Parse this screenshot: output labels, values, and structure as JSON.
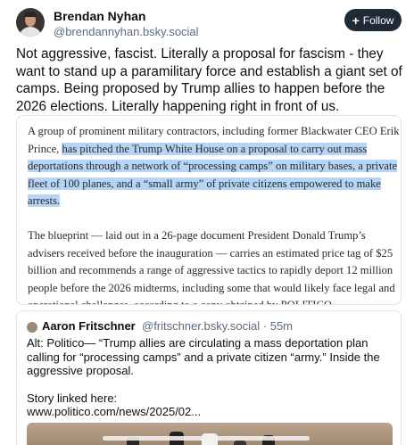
{
  "author": {
    "display_name": "Brendan Nyhan",
    "handle": "@brendannyhan.bsky.social",
    "avatar_icon": "user-avatar"
  },
  "follow_button": {
    "icon": "plus-icon",
    "label": "Follow"
  },
  "post": {
    "text": "Not aggressive, fascist. Literally a proposal for fascism - they want to stand up a paramilitary force and establish a giant set of camps. Being proposed by Trump allies to happen before the 2026 elections. Literally happening right in front of us."
  },
  "image_article": {
    "p1_before": "A group of prominent military contractors, including former Blackwater CEO Erik Prince, ",
    "p1_highlight": "has pitched the Trump White House on a proposal to carry out mass deportations through a network of “processing camps” on military bases, a private fleet of 100 planes, and a “small army” of private citizens empowered to make arrests.",
    "p2": "The blueprint — laid out in a 26-page document President Donald Trump’s advisers received before the inauguration — carries an estimated price tag of $25 billion and recommends a range of aggressive tactics to rapidly deport 12 million people before the 2026 midterms, including some that would likely face legal and operational challenges, according to a copy obtained by POLITICO.",
    "highlight_color": "#b6d4f5"
  },
  "quoted_post": {
    "display_name": "Aaron Fritschner",
    "handle_and_time": "@fritschner.bsky.social · 55m",
    "line1": "Alt: Politico— “Trump allies are circulating a mass deportation plan calling for “processing camps” and a private citizen “army.” Inside the aggressive proposal.",
    "line2": "Story linked here:",
    "line3": "www.politico.com/news/2025/02..."
  }
}
